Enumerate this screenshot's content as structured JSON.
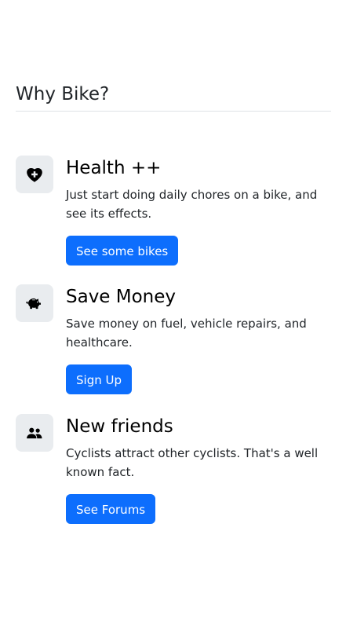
{
  "section": {
    "title": "Why Bike?"
  },
  "features": [
    {
      "icon": "heart-plus-icon",
      "heading": "Health ++",
      "text": "Just start doing daily chores on a bike, and see its effects.",
      "button": "See some bikes"
    },
    {
      "icon": "piggy-bank-icon",
      "heading": "Save Money",
      "text": "Save money on fuel, vehicle repairs, and healthcare.",
      "button": "Sign Up"
    },
    {
      "icon": "people-icon",
      "heading": "New friends",
      "text": "Cyclists attract other cyclists. That's a well known fact.",
      "button": "See Forums"
    }
  ],
  "colors": {
    "primary": "#0d6efd",
    "icon_bg": "#e9ecef",
    "text": "#212529"
  }
}
